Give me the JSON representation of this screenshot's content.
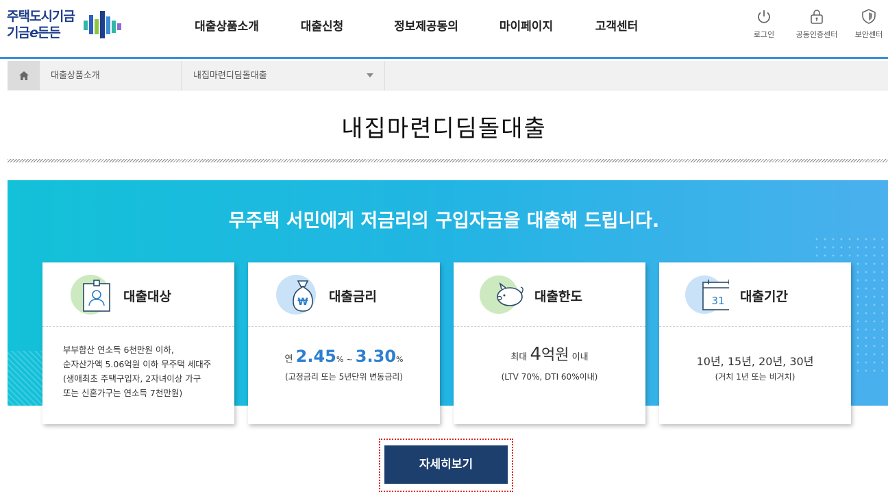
{
  "logo": {
    "line1": "주택도시기금",
    "line2_a": "기금",
    "line2_e": "e",
    "line2_b": "든든"
  },
  "nav": [
    "대출상품소개",
    "대출신청",
    "정보제공동의",
    "마이페이지",
    "고객센터"
  ],
  "utility": [
    {
      "label": "로그인",
      "icon": "power-icon"
    },
    {
      "label": "공동인증센터",
      "icon": "lock-icon"
    },
    {
      "label": "보안센터",
      "icon": "shield-icon"
    }
  ],
  "breadcrumb": {
    "home_icon": "home-icon",
    "level1": "대출상품소개",
    "level2": "내집마련디딤돌대출"
  },
  "page_title": "내집마련디딤돌대출",
  "hero_title": "무주택 서민에게 저금리의 구입자금을 대출해 드립니다.",
  "cards": {
    "target": {
      "label": "대출대상",
      "icon": "id-badge-icon",
      "lines": [
        "부부합산 연소득 6천만원 이하,",
        "순자산가액 5.06억원 이하 무주택 세대주",
        "(생애최초 주택구입자, 2자녀이상 가구",
        "또는 신혼가구는 연소득 7천만원)"
      ]
    },
    "rate": {
      "label": "대출금리",
      "icon": "money-bag-icon",
      "prefix": "연",
      "min": "2.45",
      "max": "3.30",
      "unit": "%",
      "tilde": "~",
      "note": "(고정금리 또는 5년단위 변동금리)"
    },
    "limit": {
      "label": "대출한도",
      "icon": "piggy-bank-icon",
      "prefix": "최대",
      "amount": "4",
      "amount_unit": "억원",
      "suffix": "이내",
      "note": "(LTV 70%, DTI 60%이내)"
    },
    "period": {
      "label": "대출기간",
      "icon": "calendar-icon",
      "calendar_day": "31",
      "value": "10년, 15년, 20년, 30년",
      "note": "(거치 1년 또는 비거치)"
    }
  },
  "more_button": "자세히보기",
  "colors": {
    "accent": "#2d7fd0",
    "button": "#1c3f6e",
    "hero_from": "#13c1d8",
    "hero_to": "#4ab0ee"
  }
}
